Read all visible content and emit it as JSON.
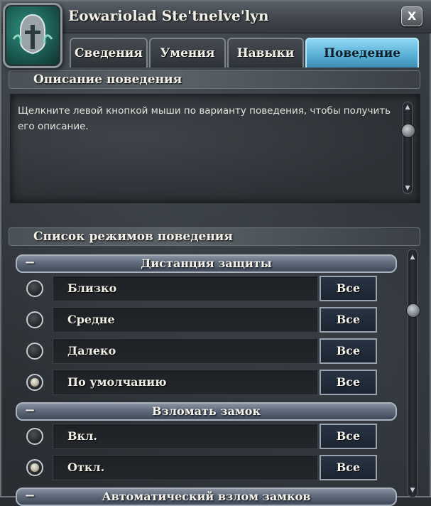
{
  "window": {
    "title": "Eowariolad Ste'tnelve'lyn",
    "close_label": "X"
  },
  "tabs": [
    {
      "label": "Сведения",
      "active": false
    },
    {
      "label": "Умения",
      "active": false
    },
    {
      "label": "Навыки",
      "active": false
    },
    {
      "label": "Поведение",
      "active": true
    }
  ],
  "description": {
    "header": "Описание поведения",
    "lines": [
      "Щелкните левой кнопкой мыши по варианту поведения, чтобы получить",
      "его описание."
    ]
  },
  "behavior_list": {
    "header": "Список режимов поведения",
    "groups": [
      {
        "title": "Дистанция защиты",
        "collapse_symbol": "−",
        "options": [
          {
            "label": "Близко",
            "selected": false,
            "all_label": "Все"
          },
          {
            "label": "Средне",
            "selected": false,
            "all_label": "Все"
          },
          {
            "label": "Далеко",
            "selected": false,
            "all_label": "Все"
          },
          {
            "label": "По умолчанию",
            "selected": true,
            "all_label": "Все"
          }
        ]
      },
      {
        "title": "Взломать замок",
        "collapse_symbol": "−",
        "options": [
          {
            "label": "Вкл.",
            "selected": false,
            "all_label": "Все"
          },
          {
            "label": "Откл.",
            "selected": true,
            "all_label": "Все"
          }
        ]
      },
      {
        "title": "Автоматический взлом замков",
        "collapse_symbol": "−",
        "options": []
      }
    ]
  },
  "colors": {
    "active_tab": "#5bb2d6",
    "group_header": "#5f6b7c",
    "panel": "#2c3136"
  }
}
